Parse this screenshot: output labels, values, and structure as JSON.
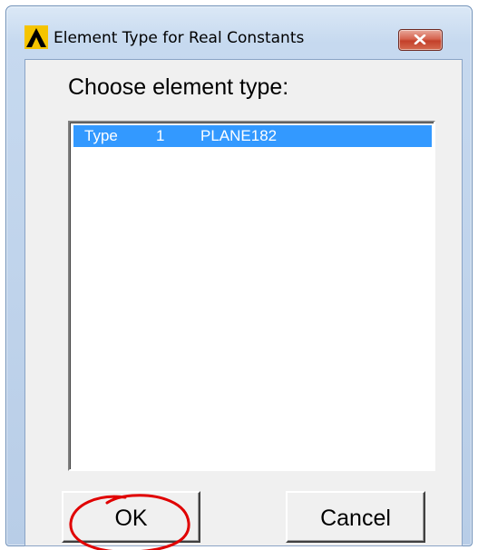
{
  "window": {
    "title": "Element Type for Real Constants"
  },
  "dialog": {
    "prompt": "Choose element type:",
    "list_items": [
      {
        "type_label": "Type",
        "number": "1",
        "element_name": "PLANE182",
        "selected": true
      }
    ]
  },
  "buttons": {
    "ok_label": "OK",
    "cancel_label": "Cancel"
  },
  "colors": {
    "selection": "#3399ff",
    "annotation": "#e00000",
    "close_button": "#c3402a"
  },
  "icons": {
    "app": "ansys-logo-icon",
    "close": "close-icon"
  }
}
